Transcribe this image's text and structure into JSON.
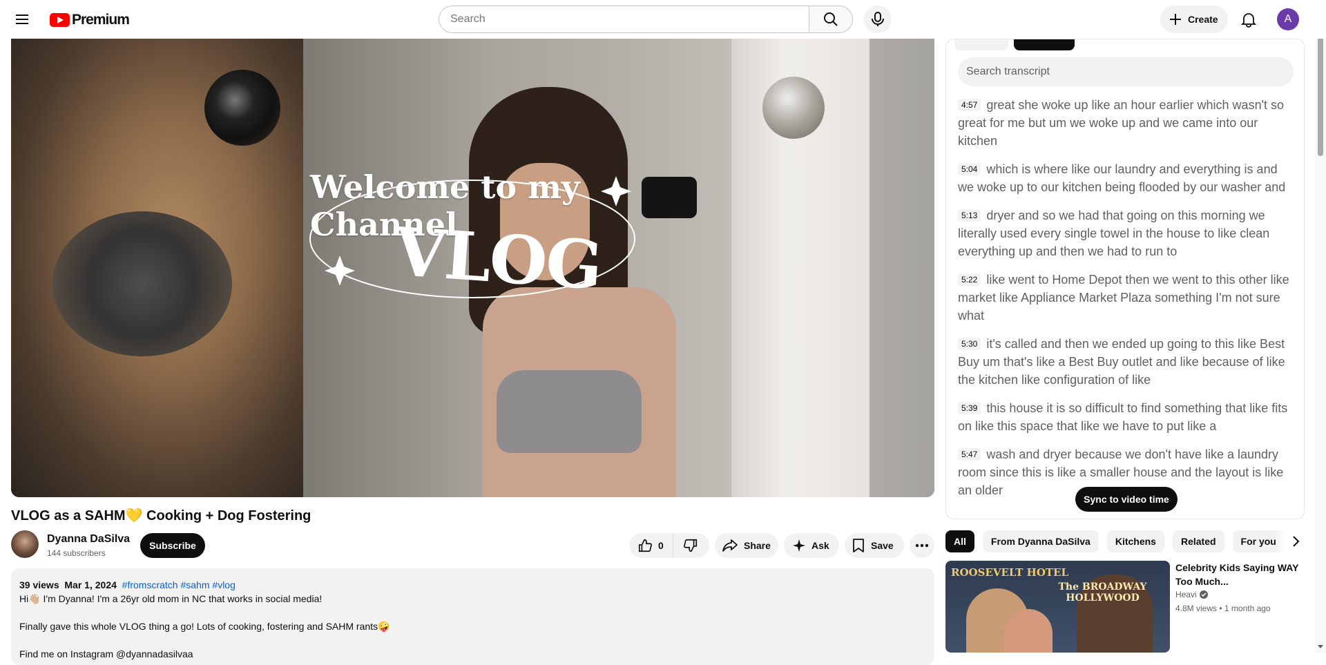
{
  "header": {
    "menu_icon": "hamburger-menu-icon",
    "logo_text": "Premium",
    "search_placeholder": "Search",
    "create_label": "Create",
    "avatar_letter": "A",
    "colors": {
      "brand_red": "#ff0000",
      "avatar_bg": "#6a3aa8"
    }
  },
  "video": {
    "overlay_title": "Welcome to my Channel",
    "overlay_vlog": "VLOG",
    "title": "VLOG as a SAHM💛 Cooking + Dog Fostering",
    "channel_name": "Dyanna DaSilva",
    "subscribers": "144 subscribers",
    "subscribe_label": "Subscribe",
    "like_count": "0",
    "share_label": "Share",
    "ask_label": "Ask",
    "save_label": "Save"
  },
  "description": {
    "views": "39 views",
    "date": "Mar 1, 2024",
    "tags": [
      "#fromscratch",
      "#sahm",
      "#vlog"
    ],
    "line1": "Hi👋🏼 I'm Dyanna! I'm a 26yr old mom in NC that works in social media!",
    "line2": "Finally gave this whole VLOG thing a go! Lots of cooking, fostering and SAHM rants🤪",
    "line3": "Find me on Instagram @dyannadasilvaa"
  },
  "transcript": {
    "search_placeholder": "Search transcript",
    "segments": [
      {
        "time": "4:57",
        "text": "great she woke up like an hour earlier which wasn't so great for me but um we woke up and we came into our kitchen"
      },
      {
        "time": "5:04",
        "text": "which is where like our laundry and everything is and we woke up to our kitchen being flooded by our washer and"
      },
      {
        "time": "5:13",
        "text": "dryer and so we had that going on this morning we literally used every single towel in the house to like clean everything up and then we had to run to"
      },
      {
        "time": "5:22",
        "text": "like went to Home Depot then we went to this other like market like Appliance Market Plaza something I'm not sure what"
      },
      {
        "time": "5:30",
        "text": "it's called and then we ended up going to this like Best Buy um that's like a Best Buy outlet and like because of like the kitchen like configuration of like"
      },
      {
        "time": "5:39",
        "text": "this house it is so difficult to find something that like fits on like this space that like we have to put like a"
      },
      {
        "time": "5:47",
        "text": "wash and dryer because we don't have like a laundry room since this is like a smaller house and the layout is like an older"
      }
    ],
    "sync_label": "Sync to video time"
  },
  "chips": [
    "All",
    "From Dyanna DaSilva",
    "Kitchens",
    "Related",
    "For you"
  ],
  "recommendation": {
    "thumb_sign1": "ROOSEVELT HOTEL",
    "thumb_sign2": "The BROADWAY HOLLYWOOD",
    "title": "Celebrity Kids Saying WAY Too Much...",
    "channel": "Heavi",
    "stats": "4.8M views • 1 month ago"
  }
}
